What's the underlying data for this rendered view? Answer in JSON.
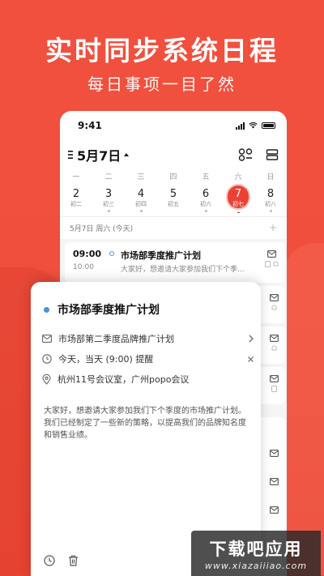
{
  "hero": {
    "title": "实时同步系统日程",
    "subtitle": "每日事项一目了然"
  },
  "status_bar": {
    "time": "9:41"
  },
  "calendar": {
    "month_title": "5月7日",
    "weekdays": [
      "一",
      "二",
      "三",
      "四",
      "五",
      "六",
      "日"
    ],
    "dates": [
      {
        "num": "2",
        "lunar": "初二",
        "dot": false
      },
      {
        "num": "3",
        "lunar": "初三",
        "dot": true
      },
      {
        "num": "4",
        "lunar": "初四",
        "dot": true
      },
      {
        "num": "5",
        "lunar": "初五",
        "dot": false
      },
      {
        "num": "6",
        "lunar": "初六",
        "dot": true
      },
      {
        "num": "7",
        "lunar": "初七",
        "dot": true,
        "selected": true
      },
      {
        "num": "8",
        "lunar": "初八",
        "dot": true
      }
    ],
    "day_label": "5月7日 周六 (今天)"
  },
  "event": {
    "start": "09:00",
    "end": "10:00",
    "title": "市场部季度推广计划",
    "desc": "大家好，想邀请大家参加我们下个季..."
  },
  "detail": {
    "title": "市场部季度推广计划",
    "mail_subject": "市场部第二季度品牌推广计划",
    "time_reminder": "今天，当天 (9:00) 提醒",
    "location": "杭州11号会议室，广州popo会议",
    "description": "大家好，想邀请大家参加我们下个季度的市场推广计划。我们已经制定了一些新的策略，以提高我们的品牌知名度和销售业绩。"
  },
  "watermark": {
    "main": "下载吧应用",
    "url": "www.xiazaiiiao.com"
  },
  "colors": {
    "background": "#ee4f3c",
    "accent_red": "#ea4335",
    "event_blue": "#4a90e2"
  }
}
